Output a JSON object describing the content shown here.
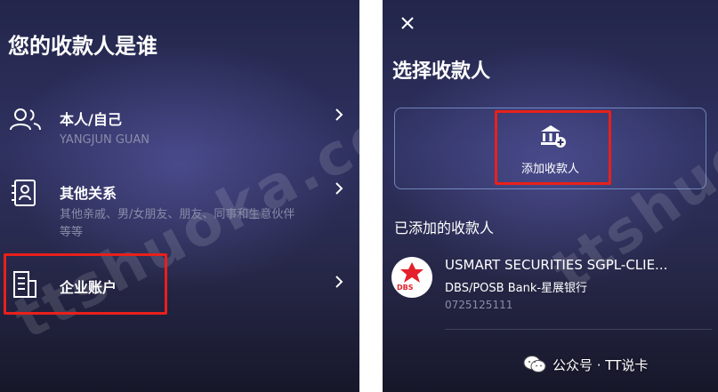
{
  "left": {
    "title": "您的收款人是谁",
    "items": [
      {
        "label": "本人/自己",
        "sublabel": "YANGJUN GUAN",
        "icon": "people-icon"
      },
      {
        "label": "其他关系",
        "sublabel_line1": "其他亲戚、男/女朋友、朋友、同事和生意伙伴",
        "sublabel_line2": "等等",
        "icon": "contact-card-icon"
      },
      {
        "label": "企业账户",
        "icon": "building-document-icon"
      }
    ]
  },
  "right": {
    "title": "选择收款人",
    "add_label": "添加收款人",
    "section_title": "已添加的收款人",
    "payee": {
      "name": "USMART SECURITIES SGPL-CLIE...",
      "bank": "DBS/POSB Bank-星展银行",
      "account": "0725125111",
      "logo_text": "DBS",
      "logo_color": "#e3202b"
    }
  },
  "watermark": {
    "text": "ttshuoka.com",
    "credit": "公众号 · TT说卡"
  },
  "colors": {
    "highlight": "#e8201b",
    "panel_bg": "#2f3160",
    "muted_text": "#8a8ca8"
  }
}
